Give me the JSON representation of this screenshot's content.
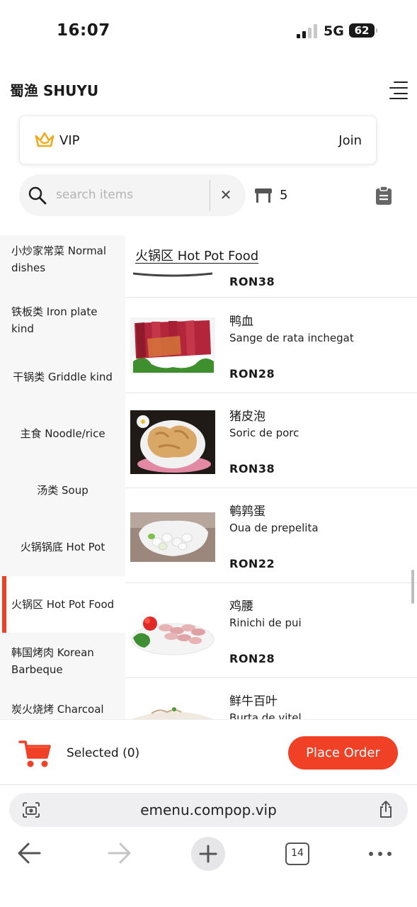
{
  "status_bar": {
    "time": "16:07",
    "network": "5G",
    "battery": "62"
  },
  "header": {
    "brand": "蜀渔 SHUYU"
  },
  "vip": {
    "label": "VIP",
    "join": "Join"
  },
  "search": {
    "placeholder": "search items",
    "value": ""
  },
  "table_number": "5",
  "sidebar": {
    "categories": [
      {
        "label": "小炒家常菜 Normal dishes",
        "active": false
      },
      {
        "label": "铁板类 Iron plate kind",
        "active": false
      },
      {
        "label": "干锅类 Griddle kind",
        "active": false
      },
      {
        "label": "主食 Noodle/rice",
        "active": false
      },
      {
        "label": "汤类 Soup",
        "active": false
      },
      {
        "label": "火锅锅底 Hot Pot",
        "active": false
      },
      {
        "label": "火锅区 Hot Pot Food",
        "active": true
      },
      {
        "label": "韩国烤肉 Korean Barbeque",
        "active": false
      },
      {
        "label": "炭火烧烤 Charcoal",
        "active": false
      }
    ]
  },
  "main": {
    "section_title": "火锅区 Hot Pot Food",
    "partial_item_price": "RON38",
    "items": [
      {
        "name_cn": "鸭血",
        "name_ro": "Sange de rata inchegat",
        "price": "RON28"
      },
      {
        "name_cn": "猪皮泡",
        "name_ro": "Soric de porc",
        "price": "RON38"
      },
      {
        "name_cn": "鹌鹑蛋",
        "name_ro": "Oua de prepelita",
        "price": "RON22"
      },
      {
        "name_cn": "鸡腰",
        "name_ro": "Rinichi de pui",
        "price": "RON28"
      },
      {
        "name_cn": "鲜牛百叶",
        "name_ro": "Burta de vitel",
        "price": ""
      }
    ]
  },
  "order_bar": {
    "selected": "Selected (0)",
    "place_order": "Place Order"
  },
  "browser": {
    "url": "emenu.compop.vip",
    "tab_count": "14"
  },
  "colors": {
    "accent": "#f04127",
    "vip_crown": "#f3a91b"
  }
}
